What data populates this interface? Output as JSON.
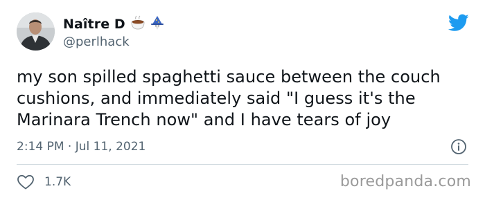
{
  "author": {
    "display_name": "Naître D",
    "handle": "@perlhack",
    "emoji_icons": [
      "coffee-bowl-icon",
      "wizard-icon"
    ]
  },
  "brand_icon": "twitter-bird-icon",
  "tweet": {
    "text": "my son spilled spaghetti sauce between the couch cushions, and immediately said \"I guess it's the Marinara Trench now\" and I have tears of joy",
    "timestamp": "2:14 PM · Jul 11, 2021",
    "likes": "1.7K"
  },
  "watermark": "boredpanda.com",
  "colors": {
    "text": "#0f1419",
    "secondary": "#536471",
    "twitter_blue": "#1d9bf0",
    "divider": "#cfd9de"
  }
}
